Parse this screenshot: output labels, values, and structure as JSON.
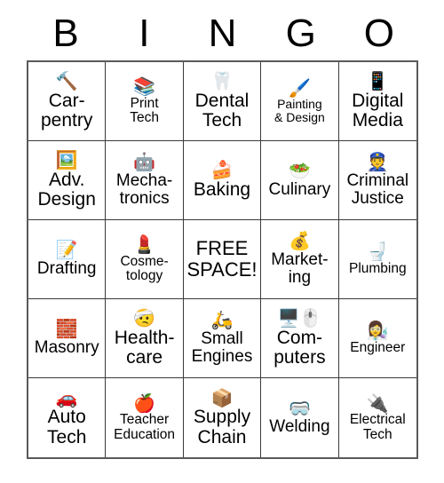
{
  "card": {
    "title": "BINGO",
    "header_letters": [
      "B",
      "I",
      "N",
      "G",
      "O"
    ],
    "grid_size": "5x5",
    "text_color": "#000000",
    "border_color": "#3a3a3a",
    "background_color": "#ffffff"
  },
  "cells": [
    {
      "label": "Car-\npentry",
      "icon": "🔨",
      "icon_name": "hammer-icon",
      "size": "lg"
    },
    {
      "label": "Print\nTech",
      "icon": "📚",
      "icon_name": "books-icon",
      "size": "sm"
    },
    {
      "label": "Dental\nTech",
      "icon": "🦷",
      "icon_name": "tooth-icon",
      "size": "lg"
    },
    {
      "label": "Painting\n& Design",
      "icon": "🖌️",
      "icon_name": "paintbrush-icon",
      "size": "xs"
    },
    {
      "label": "Digital\nMedia",
      "icon": "📱",
      "icon_name": "mobile-phone-icon",
      "size": "lg"
    },
    {
      "label": "Adv.\nDesign",
      "icon": "🖼️",
      "icon_name": "framed-picture-icon",
      "size": "lg"
    },
    {
      "label": "Mecha-\ntronics",
      "icon": "🤖",
      "icon_name": "robot-icon",
      "size": "md"
    },
    {
      "label": "Baking",
      "icon": "🍰",
      "icon_name": "shortcake-icon",
      "size": "lg"
    },
    {
      "label": "Culinary",
      "icon": "🥗",
      "icon_name": "green-salad-icon",
      "size": "md"
    },
    {
      "label": "Criminal\nJustice",
      "icon": "👮",
      "icon_name": "police-officer-icon",
      "size": "md"
    },
    {
      "label": "Drafting",
      "icon": "📝",
      "icon_name": "memo-pencil-icon",
      "size": "md"
    },
    {
      "label": "Cosme-\ntology",
      "icon": "💄",
      "icon_name": "lipstick-icon",
      "size": "sm"
    },
    {
      "label": "FREE\nSPACE!",
      "icon": "",
      "icon_name": "free-space",
      "size": "free"
    },
    {
      "label": "Market-\ning",
      "icon": "💰",
      "icon_name": "money-bag-icon",
      "size": "md"
    },
    {
      "label": "Plumbing",
      "icon": "🚽",
      "icon_name": "toilet-icon",
      "size": "sm"
    },
    {
      "label": "Masonry",
      "icon": "🧱",
      "icon_name": "brick-icon",
      "size": "md"
    },
    {
      "label": "Health-\ncare",
      "icon": "🤕",
      "icon_name": "head-bandage-icon",
      "size": "lg"
    },
    {
      "label": "Small\nEngines",
      "icon": "🛵",
      "icon_name": "motor-scooter-icon",
      "size": "md"
    },
    {
      "label": "Com-\nputers",
      "icon": "🖥️🖱️",
      "icon_name": "desktop-computer-mouse-icon",
      "size": "lg"
    },
    {
      "label": "Engineer",
      "icon": "👩‍🔬",
      "icon_name": "woman-scientist-icon",
      "size": "sm"
    },
    {
      "label": "Auto\nTech",
      "icon": "🚗",
      "icon_name": "automobile-icon",
      "size": "lg"
    },
    {
      "label": "Teacher\nEducation",
      "icon": "🍎",
      "icon_name": "red-apple-icon",
      "size": "sm"
    },
    {
      "label": "Supply\nChain",
      "icon": "📦",
      "icon_name": "package-box-icon",
      "size": "lg"
    },
    {
      "label": "Welding",
      "icon": "🥽",
      "icon_name": "goggles-icon",
      "size": "md"
    },
    {
      "label": "Electrical\nTech",
      "icon": "🔌",
      "icon_name": "electric-plug-icon",
      "size": "sm"
    }
  ]
}
